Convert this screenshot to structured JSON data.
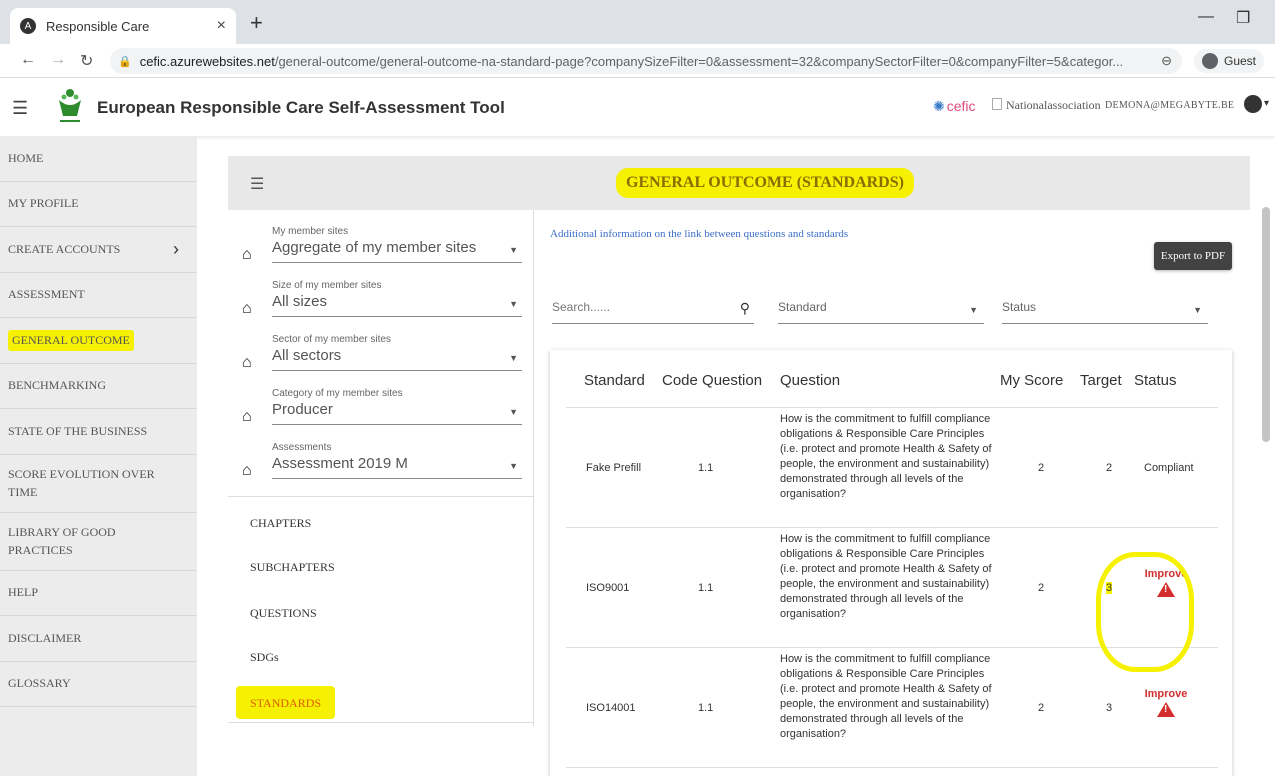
{
  "browser": {
    "tab_title": "Responsible Care",
    "tab_close": "×",
    "new_tab": "+",
    "url_host": "cefic.azurewebsites.net",
    "url_path": "/general-outcome/general-outcome-na-standard-page?companySizeFilter=0&assessment=32&companySectorFilter=0&companyFilter=5&categor...",
    "profile": "Guest"
  },
  "app": {
    "title": "European Responsible Care Self-Assessment Tool",
    "cefic": "cefic",
    "national_association": "Nationalassociation",
    "user_email": "DEMONA@MEGABYTE.BE"
  },
  "sidebar": {
    "items": [
      {
        "label": "HOME"
      },
      {
        "label": "MY PROFILE"
      },
      {
        "label": "CREATE ACCOUNTS"
      },
      {
        "label": "ASSESSMENT"
      },
      {
        "label": "GENERAL OUTCOME"
      },
      {
        "label": "BENCHMARKING"
      },
      {
        "label": "STATE OF THE BUSINESS"
      },
      {
        "label": "SCORE EVOLUTION OVER TIME"
      },
      {
        "label": "LIBRARY OF GOOD PRACTICES"
      },
      {
        "label": "HELP"
      },
      {
        "label": "DISCLAIMER"
      },
      {
        "label": "GLOSSARY"
      }
    ]
  },
  "page": {
    "title": "GENERAL OUTCOME (STANDARDS)"
  },
  "filters": [
    {
      "label": "My member sites",
      "value": "Aggregate of my member sites"
    },
    {
      "label": "Size of my member sites",
      "value": "All sizes"
    },
    {
      "label": "Sector of my member sites",
      "value": "All sectors"
    },
    {
      "label": "Category of my member sites",
      "value": "Producer"
    },
    {
      "label": "Assessments",
      "value": "Assessment 2019 M"
    }
  ],
  "nav_links": [
    "CHAPTERS",
    "SUBCHAPTERS",
    "QUESTIONS",
    "SDGs",
    "STANDARDS"
  ],
  "content": {
    "info_link": "Additional information on the link between questions and standards",
    "export_label": "Export to PDF",
    "search_placeholder": "Search......",
    "standard_dropdown": "Standard",
    "status_dropdown": "Status"
  },
  "table": {
    "headers": [
      "Standard",
      "Code Question",
      "Question",
      "My Score",
      "Target",
      "Status"
    ],
    "rows": [
      {
        "standard": "Fake Prefill",
        "code": "1.1",
        "question": "How is the commitment to fulfill compliance obligations & Responsible Care Principles (i.e. protect and promote Health & Safety of people, the environment and sustainability) demonstrated through all levels of the organisation?",
        "score": "2",
        "target": "2",
        "status": "Compliant"
      },
      {
        "standard": "ISO9001",
        "code": "1.1",
        "question": "How is the commitment to fulfill compliance obligations & Responsible Care Principles (i.e. protect and promote Health & Safety of people, the environment and sustainability) demonstrated through all levels of the organisation?",
        "score": "2",
        "target": "3",
        "status": "Improve"
      },
      {
        "standard": "ISO14001",
        "code": "1.1",
        "question": "How is the commitment to fulfill compliance obligations & Responsible Care Principles (i.e. protect and promote Health & Safety of people, the environment and sustainability) demonstrated through all levels of the organisation?",
        "score": "2",
        "target": "3",
        "status": "Improve"
      }
    ]
  },
  "colors": {
    "highlight": "#f5f100",
    "improve": "#d32f2f",
    "link": "#3b6ec8"
  }
}
